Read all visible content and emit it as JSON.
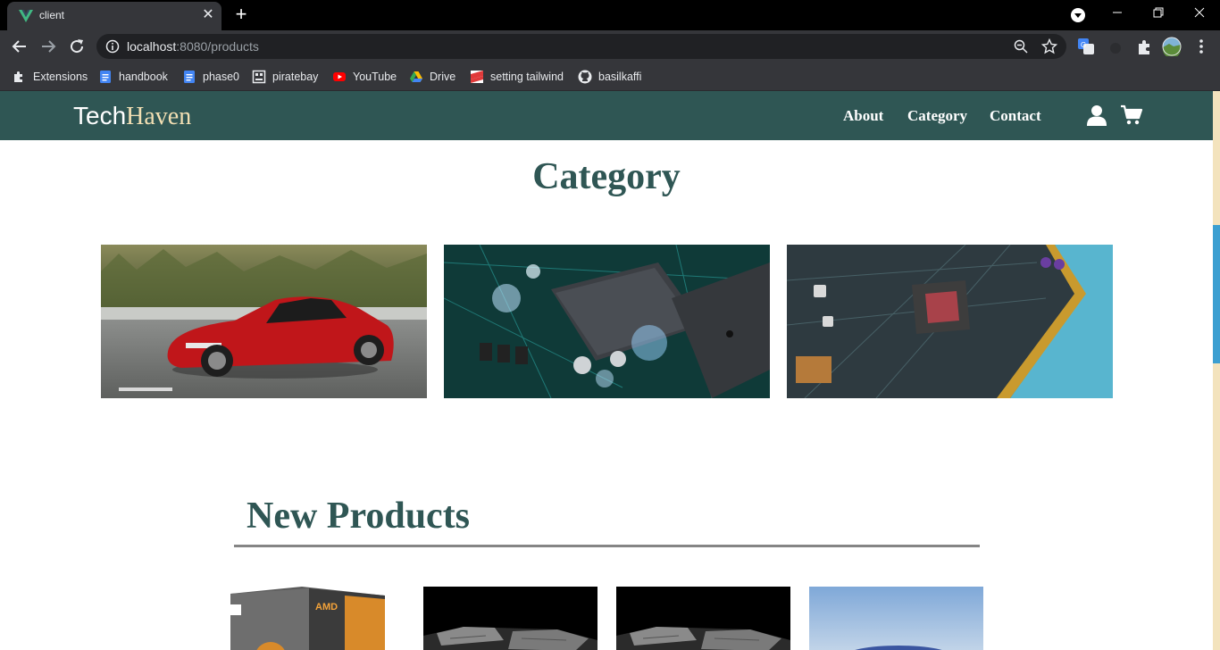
{
  "browser": {
    "tab_title": "client",
    "new_tab": "+",
    "close": "✕",
    "url_host": "localhost",
    "url_path": ":8080/products",
    "bookmarks": [
      {
        "label": "Extensions",
        "icon": "puzzle-icon"
      },
      {
        "label": "handbook",
        "icon": "docs-icon"
      },
      {
        "label": "phase0",
        "icon": "docs-icon"
      },
      {
        "label": "piratebay",
        "icon": "pirate-icon"
      },
      {
        "label": "YouTube",
        "icon": "youtube-icon"
      },
      {
        "label": "Drive",
        "icon": "drive-icon"
      },
      {
        "label": "setting tailwind",
        "icon": "bookmark-icon"
      },
      {
        "label": "basilkaffi",
        "icon": "github-icon"
      }
    ]
  },
  "site": {
    "brand_first": "Tech",
    "brand_second": "Haven",
    "nav": [
      "About",
      "Category",
      "Contact"
    ],
    "colors": {
      "nav_bg": "#2f5654",
      "heading": "#2f5654",
      "accent": "#f2dfb3"
    }
  },
  "category": {
    "heading": "Category",
    "cards": [
      {
        "image": "red-sports-car"
      },
      {
        "image": "circuit-board-chip"
      },
      {
        "image": "graphics-card-board"
      }
    ]
  },
  "new_products": {
    "heading": "New Products",
    "items": [
      {
        "image": "amd-processor-box",
        "box_label": "AMD"
      },
      {
        "image": "graphics-card"
      },
      {
        "image": "graphics-card"
      },
      {
        "image": "sky-product"
      }
    ]
  }
}
